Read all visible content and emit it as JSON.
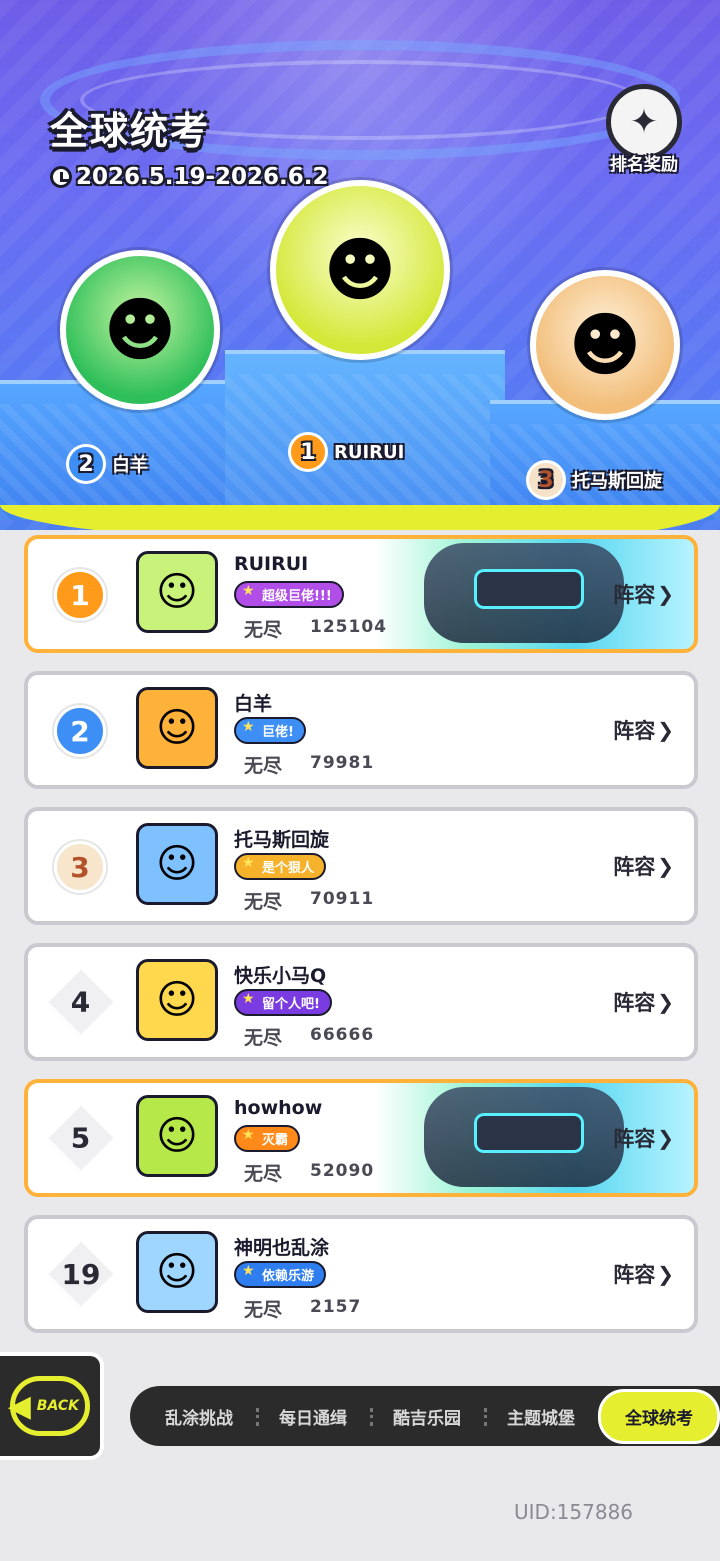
{
  "header": {
    "title": "全球统考",
    "date_range": "2026.5.19-2026.6.2",
    "reward_label": "排名奖励"
  },
  "podium": {
    "first": {
      "rank": "1",
      "name": "RUIRUI"
    },
    "second": {
      "rank": "2",
      "name": "白羊"
    },
    "third": {
      "rank": "3",
      "name": "托马斯回旋"
    }
  },
  "rows": [
    {
      "rank": "1",
      "name": "RUIRUI",
      "tag": "超级巨佬!!!",
      "mode": "无尽",
      "score": "125104",
      "lineup": "阵容"
    },
    {
      "rank": "2",
      "name": "白羊",
      "tag": "巨佬!",
      "mode": "无尽",
      "score": "79981",
      "lineup": "阵容"
    },
    {
      "rank": "3",
      "name": "托马斯回旋",
      "tag": "是个狠人",
      "mode": "无尽",
      "score": "70911",
      "lineup": "阵容"
    },
    {
      "rank": "4",
      "name": "快乐小马Q",
      "tag": "留个人吧!",
      "mode": "无尽",
      "score": "66666",
      "lineup": "阵容"
    },
    {
      "rank": "5",
      "name": "howhow",
      "tag": "灭霸",
      "mode": "无尽",
      "score": "52090",
      "lineup": "阵容"
    },
    {
      "rank": "19",
      "name": "神明也乱涂",
      "tag": "依赖乐游",
      "mode": "无尽",
      "score": "2157",
      "lineup": "阵容"
    }
  ],
  "nav": {
    "back_label": "BACK",
    "tabs": [
      "乱涂挑战",
      "每日通缉",
      "酷吉乐园",
      "主题城堡",
      "全球统考"
    ],
    "active_tab": "全球统考"
  },
  "uid": "UID:157886",
  "colors": {
    "accent_yellow": "#e6ef2f",
    "highlight_border": "#ffb23a",
    "header_blue": "#5a78f3"
  }
}
